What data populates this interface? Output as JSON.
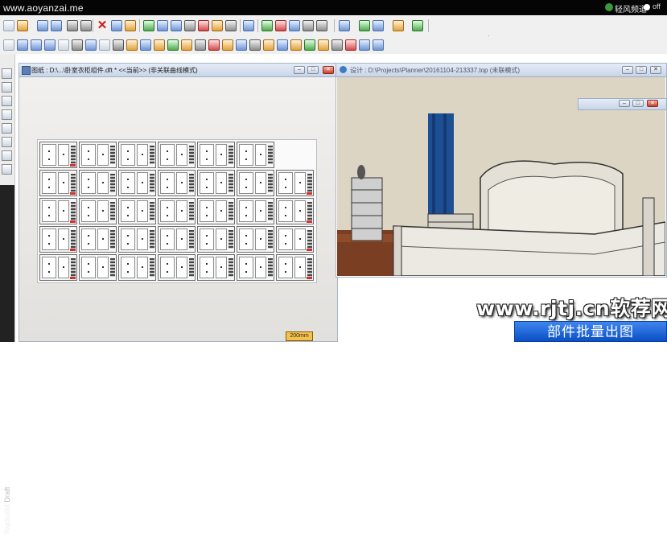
{
  "topbar": {
    "site": "www.aoyanzai.me",
    "brand": "轻风频道",
    "toggle_label": "off"
  },
  "toolbar": {
    "x_glyph": "✕",
    "dot_pattern": "• • •"
  },
  "drawing_window": {
    "title": "图纸 : D:\\...\\卧室衣柜组件.dft  *  <<当前>> (非关联曲线模式)",
    "scale_label": "200mm"
  },
  "design_window": {
    "title": "设计 : D:\\Projects\\Planner\\20161104-213337.top (未联模式)"
  },
  "window_buttons": {
    "min": "–",
    "max": "□",
    "close": "✕"
  },
  "app_label": {
    "name": "TopSolid",
    "mode": "Draft"
  },
  "watermark": {
    "url": "www.rjtj.cn软荐网",
    "banner": "部件批量出图"
  }
}
